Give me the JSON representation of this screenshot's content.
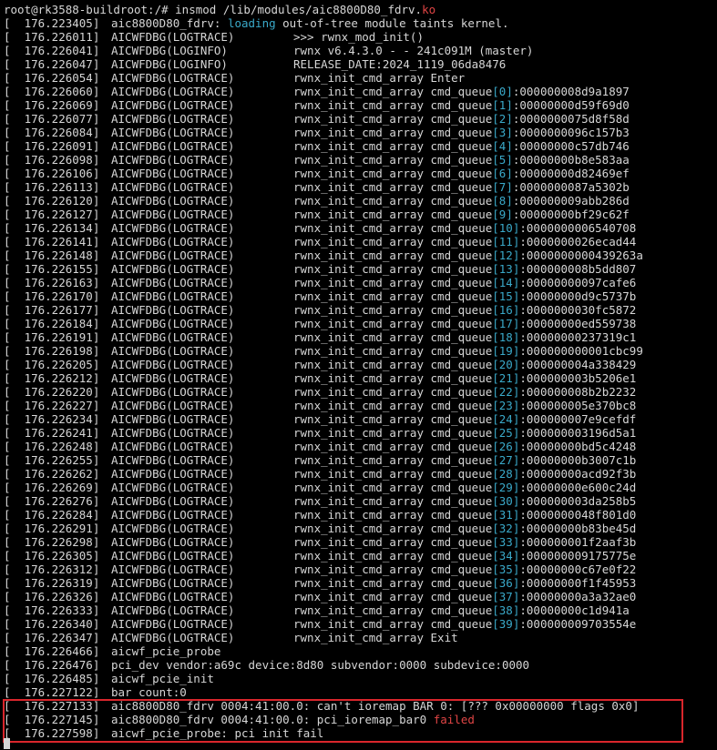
{
  "prompt": {
    "user_host": "root@rk3588-buildroot",
    "path": ":/# ",
    "command": "insmod /lib/modules/aic8800D80_fdrv.",
    "command_ext": "ko"
  },
  "colors": {
    "background": "#000000",
    "text": "#d6d6d6",
    "cyan": "#3aa9c9",
    "red": "#e04545",
    "highlight_border": "#d9262c"
  },
  "lines": [
    {
      "ts": "[  176.223405]",
      "parts": [
        {
          "t": "aic8800D80_fdrv: "
        },
        {
          "t": "loading",
          "c": "cyan"
        },
        {
          "t": " out-of-tree module taints kernel."
        }
      ]
    },
    {
      "ts": "[  176.226011]",
      "tag": "AICWFDBG(LOGTRACE)",
      "parts": [
        {
          "t": ">>> rwnx_mod_init()"
        }
      ]
    },
    {
      "ts": "[  176.226041]",
      "tag": "AICWFDBG(LOGINFO)",
      "parts": [
        {
          "t": "rwnx v6.4.3.0 - - 241c091M (master)"
        }
      ]
    },
    {
      "ts": "[  176.226047]",
      "tag": "AICWFDBG(LOGINFO)",
      "parts": [
        {
          "t": "RELEASE_DATE:2024_1119_06da8476"
        }
      ]
    },
    {
      "ts": "[  176.226054]",
      "tag": "AICWFDBG(LOGTRACE)",
      "parts": [
        {
          "t": "rwnx_init_cmd_array Enter"
        }
      ]
    },
    {
      "ts": "[  176.226060]",
      "tag": "AICWFDBG(LOGTRACE)",
      "q": "0",
      "v": "000000008d9a1897"
    },
    {
      "ts": "[  176.226069]",
      "tag": "AICWFDBG(LOGTRACE)",
      "q": "1",
      "v": "00000000d59f69d0"
    },
    {
      "ts": "[  176.226077]",
      "tag": "AICWFDBG(LOGTRACE)",
      "q": "2",
      "v": "0000000075d8f58d"
    },
    {
      "ts": "[  176.226084]",
      "tag": "AICWFDBG(LOGTRACE)",
      "q": "3",
      "v": "0000000096c157b3"
    },
    {
      "ts": "[  176.226091]",
      "tag": "AICWFDBG(LOGTRACE)",
      "q": "4",
      "v": "00000000c57db746"
    },
    {
      "ts": "[  176.226098]",
      "tag": "AICWFDBG(LOGTRACE)",
      "q": "5",
      "v": "00000000b8e583aa"
    },
    {
      "ts": "[  176.226106]",
      "tag": "AICWFDBG(LOGTRACE)",
      "q": "6",
      "v": "00000000d82469ef"
    },
    {
      "ts": "[  176.226113]",
      "tag": "AICWFDBG(LOGTRACE)",
      "q": "7",
      "v": "0000000087a5302b"
    },
    {
      "ts": "[  176.226120]",
      "tag": "AICWFDBG(LOGTRACE)",
      "q": "8",
      "v": "000000009abb286d"
    },
    {
      "ts": "[  176.226127]",
      "tag": "AICWFDBG(LOGTRACE)",
      "q": "9",
      "v": "00000000bf29c62f"
    },
    {
      "ts": "[  176.226134]",
      "tag": "AICWFDBG(LOGTRACE)",
      "q": "10",
      "v": "0000000006540708"
    },
    {
      "ts": "[  176.226141]",
      "tag": "AICWFDBG(LOGTRACE)",
      "q": "11",
      "v": "0000000026ecad44"
    },
    {
      "ts": "[  176.226148]",
      "tag": "AICWFDBG(LOGTRACE)",
      "q": "12",
      "v": "0000000000439263a"
    },
    {
      "ts": "[  176.226155]",
      "tag": "AICWFDBG(LOGTRACE)",
      "q": "13",
      "v": "000000008b5dd807"
    },
    {
      "ts": "[  176.226163]",
      "tag": "AICWFDBG(LOGTRACE)",
      "q": "14",
      "v": "00000000097cafe6"
    },
    {
      "ts": "[  176.226170]",
      "tag": "AICWFDBG(LOGTRACE)",
      "q": "15",
      "v": "00000000d9c5737b"
    },
    {
      "ts": "[  176.226177]",
      "tag": "AICWFDBG(LOGTRACE)",
      "q": "16",
      "v": "0000000030fc5872"
    },
    {
      "ts": "[  176.226184]",
      "tag": "AICWFDBG(LOGTRACE)",
      "q": "17",
      "v": "00000000ed559738"
    },
    {
      "ts": "[  176.226191]",
      "tag": "AICWFDBG(LOGTRACE)",
      "q": "18",
      "v": "00000000237319c1"
    },
    {
      "ts": "[  176.226198]",
      "tag": "AICWFDBG(LOGTRACE)",
      "q": "19",
      "v": "000000000001cbc99"
    },
    {
      "ts": "[  176.226205]",
      "tag": "AICWFDBG(LOGTRACE)",
      "q": "20",
      "v": "000000004a338429"
    },
    {
      "ts": "[  176.226212]",
      "tag": "AICWFDBG(LOGTRACE)",
      "q": "21",
      "v": "000000003b5206e1"
    },
    {
      "ts": "[  176.226220]",
      "tag": "AICWFDBG(LOGTRACE)",
      "q": "22",
      "v": "000000008b2b2232"
    },
    {
      "ts": "[  176.226227]",
      "tag": "AICWFDBG(LOGTRACE)",
      "q": "23",
      "v": "000000005e370bc8"
    },
    {
      "ts": "[  176.226234]",
      "tag": "AICWFDBG(LOGTRACE)",
      "q": "24",
      "v": "000000007e9cefdf"
    },
    {
      "ts": "[  176.226241]",
      "tag": "AICWFDBG(LOGTRACE)",
      "q": "25",
      "v": "000000003196d5a1"
    },
    {
      "ts": "[  176.226248]",
      "tag": "AICWFDBG(LOGTRACE)",
      "q": "26",
      "v": "00000000bd5c4248"
    },
    {
      "ts": "[  176.226255]",
      "tag": "AICWFDBG(LOGTRACE)",
      "q": "27",
      "v": "00000000b3007c1b"
    },
    {
      "ts": "[  176.226262]",
      "tag": "AICWFDBG(LOGTRACE)",
      "q": "28",
      "v": "00000000acd92f3b"
    },
    {
      "ts": "[  176.226269]",
      "tag": "AICWFDBG(LOGTRACE)",
      "q": "29",
      "v": "00000000e600c24d"
    },
    {
      "ts": "[  176.226276]",
      "tag": "AICWFDBG(LOGTRACE)",
      "q": "30",
      "v": "000000003da258b5"
    },
    {
      "ts": "[  176.226284]",
      "tag": "AICWFDBG(LOGTRACE)",
      "q": "31",
      "v": "0000000048f801d0"
    },
    {
      "ts": "[  176.226291]",
      "tag": "AICWFDBG(LOGTRACE)",
      "q": "32",
      "v": "00000000b83be45d"
    },
    {
      "ts": "[  176.226298]",
      "tag": "AICWFDBG(LOGTRACE)",
      "q": "33",
      "v": "000000001f2aaf3b"
    },
    {
      "ts": "[  176.226305]",
      "tag": "AICWFDBG(LOGTRACE)",
      "q": "34",
      "v": "000000009175775e"
    },
    {
      "ts": "[  176.226312]",
      "tag": "AICWFDBG(LOGTRACE)",
      "q": "35",
      "v": "00000000c67e0f22"
    },
    {
      "ts": "[  176.226319]",
      "tag": "AICWFDBG(LOGTRACE)",
      "q": "36",
      "v": "00000000f1f45953"
    },
    {
      "ts": "[  176.226326]",
      "tag": "AICWFDBG(LOGTRACE)",
      "q": "37",
      "v": "00000000a3a32ae0"
    },
    {
      "ts": "[  176.226333]",
      "tag": "AICWFDBG(LOGTRACE)",
      "q": "38",
      "v": "00000000c1d941a"
    },
    {
      "ts": "[  176.226340]",
      "tag": "AICWFDBG(LOGTRACE)",
      "q": "39",
      "v": "000000009703554e"
    },
    {
      "ts": "[  176.226347]",
      "tag": "AICWFDBG(LOGTRACE)",
      "parts": [
        {
          "t": "rwnx_init_cmd_array Exit"
        }
      ]
    },
    {
      "ts": "[  176.226466]",
      "parts": [
        {
          "t": "aicwf_pcie_probe"
        }
      ]
    },
    {
      "ts": "[  176.226476]",
      "parts": [
        {
          "t": "pci_dev vendor:a69c device:8d80 subvendor:0000 subdevice:0000"
        }
      ]
    },
    {
      "ts": "[  176.226485]",
      "parts": [
        {
          "t": "aicwf_pcie_init"
        }
      ]
    },
    {
      "ts": "[  176.227122]",
      "parts": [
        {
          "t": "bar count:0"
        }
      ]
    },
    {
      "ts": "[  176.227133]",
      "parts": [
        {
          "t": "aic8800D80_fdrv 0004:41:00.0: can't ioremap BAR 0: [??? 0x00000000 flags 0x0]"
        }
      ]
    },
    {
      "ts": "[  176.227145]",
      "parts": [
        {
          "t": "aic8800D80_fdrv 0004:41:00.0: pci_ioremap_bar0 "
        },
        {
          "t": "failed",
          "c": "red"
        }
      ]
    },
    {
      "ts": "[  176.227598]",
      "parts": [
        {
          "t": "aicwf_pcie_probe: pci init fail"
        }
      ]
    }
  ],
  "cmd_queue_label": "rwnx_init_cmd_array cmd_queue"
}
